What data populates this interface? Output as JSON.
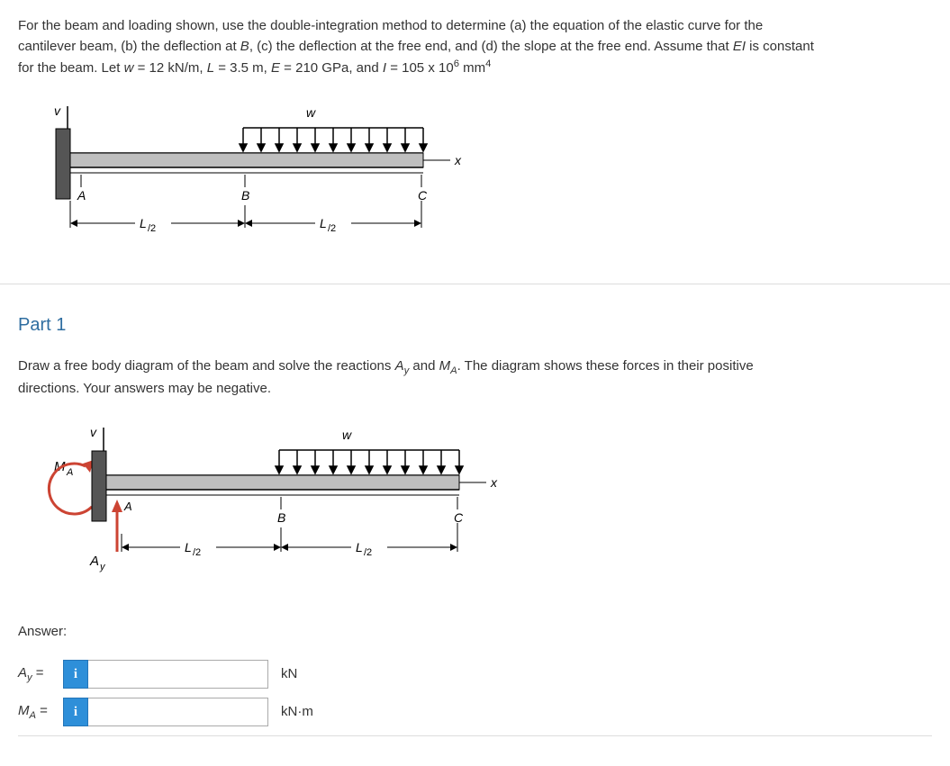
{
  "problem": {
    "line1": "For the beam and loading shown, use the double-integration method to determine (a) the equation of the elastic curve for the",
    "line2_pre": "cantilever beam, (b) the deflection at ",
    "line2_b": "B",
    "line2_mid": ", (c) the deflection at the free end, and (d) the slope at the free end. Assume that ",
    "line2_ei": "EI",
    "line2_post": " is constant",
    "line3_pre": "for the beam. Let ",
    "line3_w": "w",
    "line3_wval": " = 12 kN/m, ",
    "line3_L": "L",
    "line3_Lval": " = 3.5 m, ",
    "line3_E": "E",
    "line3_Eval": " = 210 GPa, and ",
    "line3_I": "I",
    "line3_Ival_pre": " = 105 x 10",
    "line3_Ival_sup": "6",
    "line3_Ival_post": " mm",
    "line3_Ival_sup2": "4"
  },
  "fig1": {
    "v": "v",
    "w": "w",
    "x": "x",
    "A": "A",
    "B": "B",
    "C": "C",
    "Lhalf1": "L",
    "sub12_1": "/2",
    "Lhalf2": "L",
    "sub12_2": "/2"
  },
  "part1": {
    "title": "Part 1",
    "text_pre": "Draw a free body diagram of the beam and solve the reactions ",
    "text_Ay": "A",
    "text_Ay_sub": "y",
    "text_mid": " and ",
    "text_MA": "M",
    "text_MA_sub": "A",
    "text_post": ". The diagram shows these forces in their positive",
    "text_line2": "directions. Your answers may be negative."
  },
  "fig2": {
    "v": "v",
    "w": "w",
    "x": "x",
    "MA": "M",
    "MA_sub": "A",
    "A": "A",
    "B": "B",
    "C": "C",
    "Ay": "A",
    "Ay_sub": "y",
    "Lhalf1": "L",
    "sub12_1": "/2",
    "Lhalf2": "L",
    "sub12_2": "/2"
  },
  "answer": {
    "label": "Answer:",
    "row1_var": "A",
    "row1_sub": "y",
    "row1_eq": " = ",
    "row1_unit": "kN",
    "row2_var": "M",
    "row2_sub": "A",
    "row2_eq": " = ",
    "row2_unit": "kN·m",
    "info_icon": "i"
  }
}
